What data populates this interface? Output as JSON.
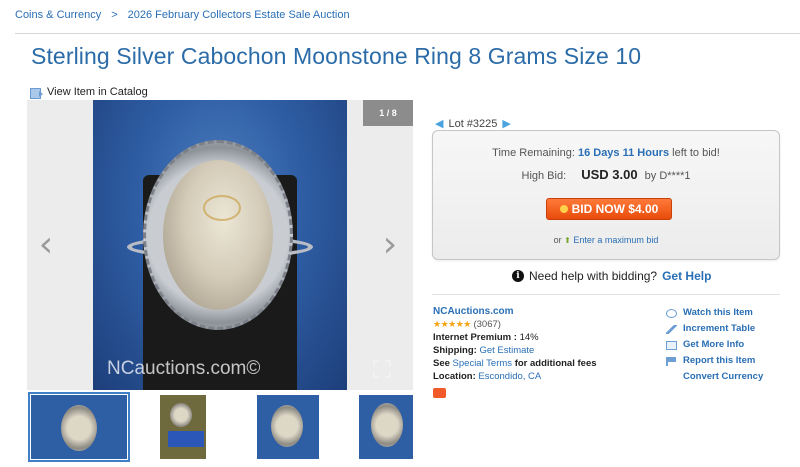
{
  "breadcrumb": {
    "items": [
      "Coins & Currency",
      "2026 February Collectors Estate Sale Auction"
    ],
    "separator": ">"
  },
  "title": "Sterling Silver Cabochon Moonstone Ring 8 Grams Size 10",
  "catalog_link": "View Item in Catalog",
  "viewer": {
    "counter": "1 / 8",
    "watermark": "NCauctions.com©",
    "prev_glyph": "‹",
    "next_glyph": "›"
  },
  "lot": {
    "label": "Lot #3225"
  },
  "bidbox": {
    "time_label": "Time Remaining:",
    "time_value": "16 Days 11 Hours",
    "time_suffix": "left to bid!",
    "high_bid_label": "High Bid:",
    "high_bid_amount": "USD 3.00",
    "high_bidder": "by D****1",
    "bid_button": "BID NOW $4.00",
    "or_text": "or",
    "max_bid_link": "Enter a maximum bid"
  },
  "help": {
    "text": "Need help with bidding?",
    "link": "Get Help"
  },
  "seller": {
    "name": "NCAuctions.com",
    "stars": "★★★★★",
    "rating_count": "(3067)",
    "premium_label": "Internet Premium :",
    "premium_value": "14%",
    "shipping_label": "Shipping:",
    "shipping_link": "Get Estimate",
    "see_text": "See",
    "terms_link": "Special Terms",
    "terms_suffix": "for additional fees",
    "location_label": "Location:",
    "location_value": "Escondido, CA"
  },
  "actions": [
    "Watch this Item",
    "Increment Table",
    "Get More Info",
    "Report this Item",
    "Convert Currency"
  ],
  "colors": {
    "link": "#2a6fb5",
    "title": "#2b6ca8",
    "bid_button": "#e84b0a",
    "star": "#f3a312"
  }
}
